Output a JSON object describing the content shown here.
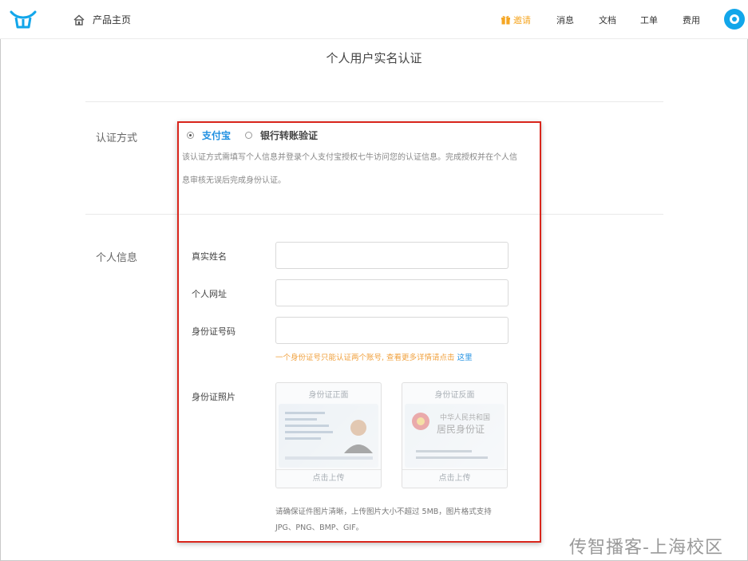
{
  "nav": {
    "home_label": "产品主页",
    "invite_label": "邀请",
    "messages_label": "消息",
    "docs_label": "文档",
    "tickets_label": "工单",
    "billing_label": "费用"
  },
  "page": {
    "title": "个人用户实名认证"
  },
  "auth_method": {
    "label": "认证方式",
    "options": [
      {
        "label": "支付宝",
        "selected": true
      },
      {
        "label": "银行转账验证",
        "selected": false
      }
    ],
    "description_line1": "该认证方式需填写个人信息并登录个人支付宝授权七牛访问您的认证信息。完成授权并在个人信",
    "description_line2": "息审核无误后完成身份认证。"
  },
  "personal_info": {
    "label": "个人信息",
    "fields": {
      "real_name": {
        "label": "真实姓名",
        "value": ""
      },
      "website": {
        "label": "个人网址",
        "value": ""
      },
      "id_number": {
        "label": "身份证号码",
        "value": ""
      }
    },
    "id_hint": "一个身份证号只能认证两个账号, 查看更多详情请点击",
    "id_hint_link": "这里",
    "photo_label": "身份证照片",
    "upload_front": {
      "title": "身份证正面",
      "action": "点击上传"
    },
    "upload_back": {
      "title": "身份证反面",
      "action": "点击上传",
      "card_line1": "中华人民共和国",
      "card_line2": "居民身份证"
    },
    "upload_note_line1": "请确保证件图片清晰，上传图片大小不超过 5MB，图片格式支持",
    "upload_note_line2": "JPG、PNG、BMP、GIF。"
  },
  "watermark": "传智播客-上海校区",
  "colors": {
    "accent": "#1e8fe1",
    "invite": "#f5a623",
    "highlight_border": "#d9261c"
  }
}
